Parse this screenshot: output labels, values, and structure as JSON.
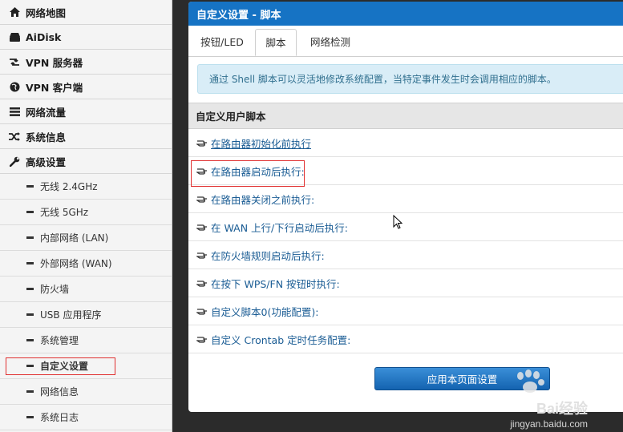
{
  "sidebar": {
    "items": [
      {
        "label": "网络地图",
        "icon": "home-icon"
      },
      {
        "label": "AiDisk",
        "icon": "hdd-icon"
      },
      {
        "label": "VPN 服务器",
        "icon": "retweet-icon"
      },
      {
        "label": "VPN 客户端",
        "icon": "globe-icon"
      },
      {
        "label": "网络流量",
        "icon": "list-icon"
      },
      {
        "label": "系统信息",
        "icon": "random-icon"
      },
      {
        "label": "高级设置",
        "icon": "wrench-icon"
      }
    ],
    "sub_items": [
      {
        "label": "无线 2.4GHz"
      },
      {
        "label": "无线 5GHz"
      },
      {
        "label": "内部网络 (LAN)"
      },
      {
        "label": "外部网络 (WAN)"
      },
      {
        "label": "防火墙"
      },
      {
        "label": "USB 应用程序"
      },
      {
        "label": "系统管理"
      },
      {
        "label": "自定义设置",
        "active": true
      },
      {
        "label": "网络信息"
      },
      {
        "label": "系统日志"
      }
    ]
  },
  "panel": {
    "title": "自定义设置 - 脚本",
    "tabs": [
      {
        "label": "按钮/LED"
      },
      {
        "label": "脚本",
        "active": true
      },
      {
        "label": "网络检测"
      }
    ],
    "info": "通过 Shell 脚本可以灵活地修改系统配置，当特定事件发生时会调用相应的脚本。",
    "section_title": "自定义用户脚本",
    "scripts": [
      {
        "label": "在路由器初始化前执行"
      },
      {
        "label": "在路由器启动后执行:"
      },
      {
        "label": "在路由器关闭之前执行:"
      },
      {
        "label": "在 WAN 上行/下行启动后执行:"
      },
      {
        "label": "在防火墙规则启动后执行:"
      },
      {
        "label": "在按下 WPS/FN 按钮时执行:"
      },
      {
        "label": "自定义脚本0(功能配置):"
      },
      {
        "label": "自定义 Crontab 定时任务配置:"
      }
    ],
    "apply_label": "应用本页面设置"
  },
  "watermark": {
    "text": "Bai经验",
    "sub": "jingyan.baidu.com"
  },
  "colors": {
    "header_blue": "#1673c4",
    "info_bg": "#d9edf7",
    "link": "#1a5c94",
    "highlight_red": "#e03030"
  }
}
